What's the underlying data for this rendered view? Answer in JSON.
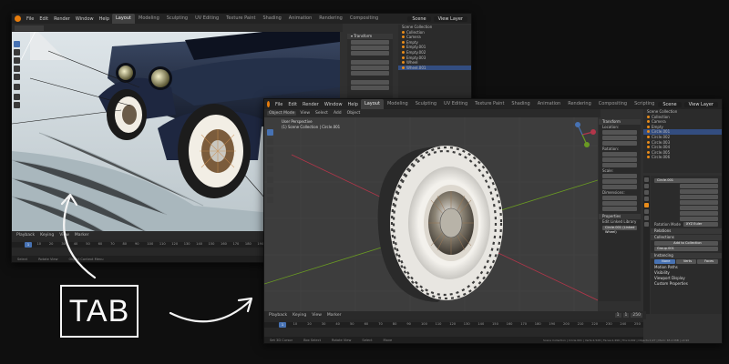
{
  "key_label": "TAB",
  "colors": {
    "blender_orange": "#e87d0d",
    "select_blue": "#4772b3",
    "axis_red": "#b3364a",
    "axis_green": "#6a9a23"
  },
  "window_back": {
    "menus": [
      "File",
      "Edit",
      "Render",
      "Window",
      "Help"
    ],
    "workspaces": [
      "Layout",
      "Modeling",
      "Sculpting",
      "UV Editing",
      "Texture Paint",
      "Shading",
      "Animation",
      "Rendering",
      "Compositing"
    ],
    "active_workspace": "Layout",
    "scene": "Scene",
    "view_layer": "View Layer",
    "outliner_rows": [
      "Scene Collection",
      "Collection",
      "Camera",
      "Empty",
      "Empty.001",
      "Empty.002",
      "Empty.003",
      "Wheel",
      "Wheel.001"
    ],
    "playback": [
      "Playback",
      "Keying",
      "View",
      "Marker"
    ],
    "frame_current": "1",
    "ruler": [
      "0",
      "10",
      "20",
      "30",
      "40",
      "50",
      "60",
      "70",
      "80",
      "90",
      "100",
      "110",
      "120",
      "130",
      "140",
      "150",
      "160",
      "170",
      "180",
      "190",
      "200",
      "210",
      "220",
      "230",
      "240",
      "250"
    ],
    "status": [
      "Select",
      "Rotate View",
      "Object Context Menu"
    ]
  },
  "window_front": {
    "menus": [
      "File",
      "Edit",
      "Render",
      "Window",
      "Help"
    ],
    "workspaces": [
      "Layout",
      "Modeling",
      "Sculpting",
      "UV Editing",
      "Texture Paint",
      "Shading",
      "Animation",
      "Rendering",
      "Compositing",
      "Scripting"
    ],
    "active_workspace": "Layout",
    "scene": "Scene",
    "view_layer": "View Layer",
    "object_mode": "Object Mode",
    "viewport_menus": [
      "View",
      "Select",
      "Add",
      "Object"
    ],
    "view_title": "User Perspective",
    "view_subtitle": "(1) Scene Collection | Circle.001",
    "outliner_rows": [
      "Scene Collection",
      "Collection",
      "Camera",
      "Empty",
      "Circle.001",
      "Circle.002",
      "Circle.003",
      "Circle.004",
      "Circle.005",
      "Circle.006"
    ],
    "transform_title": "Transform",
    "transform_sections": [
      "Location:",
      "Rotation:",
      "Scale:",
      "Dimensions:"
    ],
    "properties_title": "Properties",
    "linked_library": "Edit Linked Library",
    "linked_value": "Circle.001 (Linked Wheel)",
    "object_name": "Circle.001",
    "relations_header": "Relations",
    "collections_header": "Collections",
    "add_collection": "Add to Collection",
    "group_name": "Group.001",
    "instancing_header": "Instancing",
    "instancing_opts": [
      "None",
      "Verts",
      "Faces"
    ],
    "extra_headers": [
      "Motion Paths",
      "Visibility",
      "Viewport Display",
      "Custom Properties"
    ],
    "rotation_mode": "XYZ Euler",
    "rotation_mode_label": "Rotation Mode",
    "playback": [
      "Playback",
      "Keying",
      "View",
      "Marker"
    ],
    "frame_current": "1",
    "frame_start": "1",
    "frame_end": "250",
    "ruler": [
      "0",
      "10",
      "20",
      "30",
      "40",
      "50",
      "60",
      "70",
      "80",
      "90",
      "100",
      "110",
      "120",
      "130",
      "140",
      "150",
      "160",
      "170",
      "180",
      "190",
      "200",
      "210",
      "220",
      "230",
      "240",
      "250"
    ],
    "status": [
      "Set 3D Cursor",
      "Box Select",
      "Rotate View",
      "Select",
      "Move"
    ],
    "status_right": "Scene Collection | Circle.001 | Verts:2,528 | Faces:2,496 | Tris:4,992 | Objects:1/27 | Mem: 65.2 MiB | v2.90"
  }
}
